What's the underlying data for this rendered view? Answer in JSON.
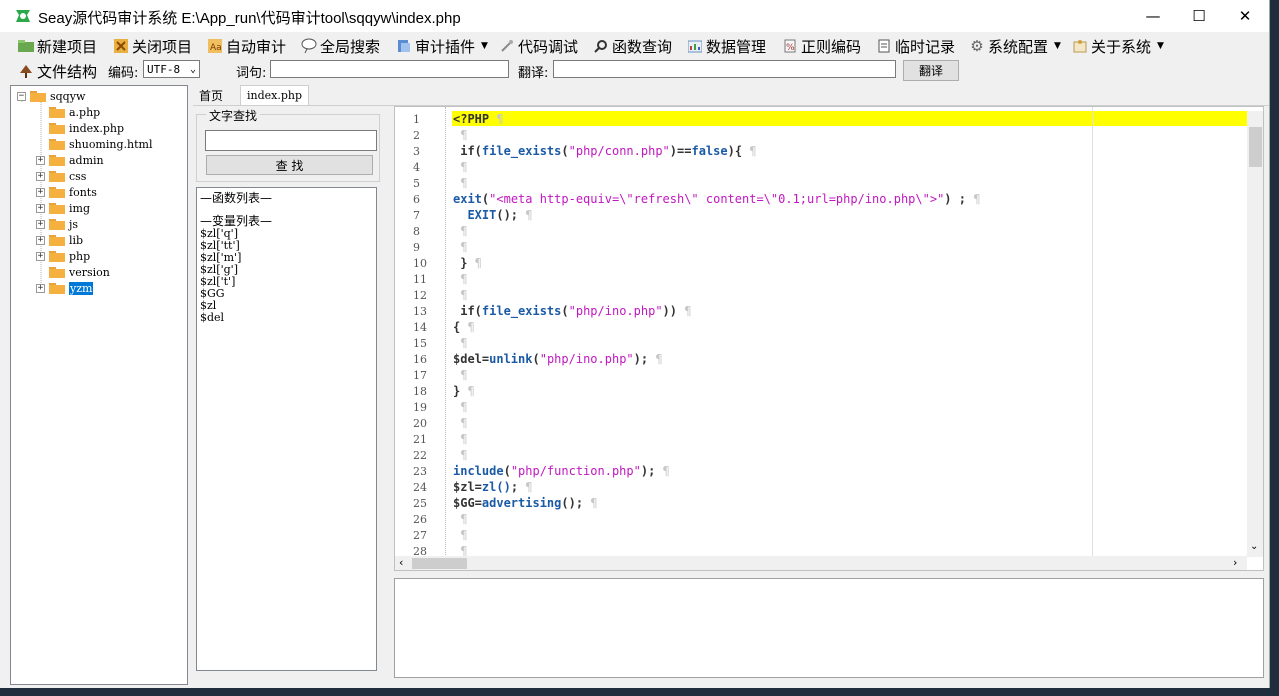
{
  "window": {
    "title": "Seay源代码审计系统  E:\\App_run\\代码审计tool\\sqqyw\\index.php",
    "minimize": "—",
    "maximize": "☐",
    "close": "✕"
  },
  "menu": {
    "items": [
      {
        "label": "新建项目",
        "icon": "new-project-icon"
      },
      {
        "label": "关闭项目",
        "icon": "close-project-icon"
      },
      {
        "label": "自动审计",
        "icon": "auto-audit-icon"
      },
      {
        "label": "全局搜索",
        "icon": "global-search-icon"
      },
      {
        "label": "审计插件",
        "icon": "plugin-icon"
      },
      {
        "label": "代码调试",
        "icon": "debug-icon"
      },
      {
        "label": "函数查询",
        "icon": "function-query-icon"
      },
      {
        "label": "数据管理",
        "icon": "data-manage-icon"
      },
      {
        "label": "正则编码",
        "icon": "regex-icon"
      },
      {
        "label": "临时记录",
        "icon": "notes-icon"
      },
      {
        "label": "系统配置",
        "icon": "gear-icon"
      },
      {
        "label": "关于系统",
        "icon": "about-icon"
      }
    ]
  },
  "toolbar": {
    "file_structure": "文件结构",
    "encoding_label": "编码:",
    "encoding_value": "UTF-8",
    "word_label": "词句:",
    "word_value": "",
    "translate_label": "翻译:",
    "translate_value": "",
    "translate_button": "翻译"
  },
  "tree": {
    "root": "sqqyw",
    "items": [
      {
        "name": "a.php",
        "expandable": false
      },
      {
        "name": "index.php",
        "expandable": false
      },
      {
        "name": "shuoming.html",
        "expandable": false
      },
      {
        "name": "admin",
        "expandable": true
      },
      {
        "name": "css",
        "expandable": true
      },
      {
        "name": "fonts",
        "expandable": true
      },
      {
        "name": "img",
        "expandable": true
      },
      {
        "name": "js",
        "expandable": true
      },
      {
        "name": "lib",
        "expandable": true
      },
      {
        "name": "php",
        "expandable": true
      },
      {
        "name": "version",
        "expandable": false
      },
      {
        "name": "yzm",
        "expandable": true,
        "selected": true
      }
    ]
  },
  "tabs": [
    {
      "label": "首页",
      "active": false
    },
    {
      "label": "index.php",
      "active": true
    }
  ],
  "search": {
    "legend": "文字查找",
    "input_value": "",
    "button_label": "查 找"
  },
  "function_list": {
    "header": "—函数列表—",
    "items": []
  },
  "variable_list": {
    "header": "—变量列表—",
    "items": [
      "$zl['q']",
      "$zl['tt']",
      "$zl['m']",
      "$zl['g']",
      "$zl['t']",
      "$GG",
      "$zl",
      "$del"
    ]
  },
  "editor": {
    "line_numbers": [
      "1",
      "2",
      "3",
      "4",
      "5",
      "6",
      "7",
      "8",
      "9",
      "10",
      "11",
      "12",
      "13",
      "14",
      "15",
      "16",
      "17",
      "18",
      "19",
      "20",
      "21",
      "22",
      "23",
      "24",
      "25",
      "26",
      "27",
      "28"
    ],
    "lines": [
      "<?PHP",
      "",
      " if(file_exists(\"php/conn.php\")==false){",
      "",
      "",
      "exit(\"<meta http-equiv=\\\"refresh\\\" content=\\\"0.1;url=php/ino.php\\\">\") ;",
      "  EXIT();",
      "",
      "",
      " }",
      "",
      "",
      " if(file_exists(\"php/ino.php\"))",
      "{",
      "",
      "$del=unlink(\"php/ino.php\");",
      "",
      "}",
      "",
      "",
      "",
      "",
      "include(\"php/function.php\");",
      "$zl=zl();",
      "$GG=advertising();",
      "",
      "",
      ""
    ]
  },
  "colors": {
    "current_line": "#ffff00",
    "keyword": "#1b5aa6",
    "string": "#c018c0",
    "selection": "#0078d7"
  }
}
